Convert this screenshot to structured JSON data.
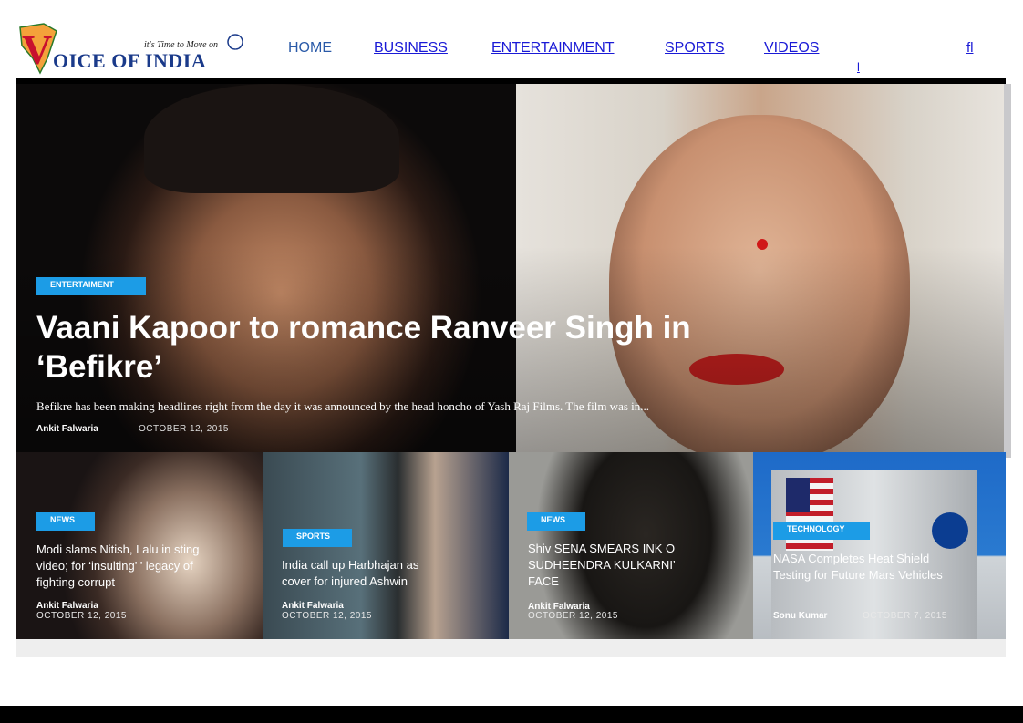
{
  "logo": {
    "letter": "V",
    "wordmark": "OICE OF INDIA",
    "tagline": "it's Time to Move on"
  },
  "nav": {
    "items": [
      "HOME",
      "BUSINESS",
      "ENTERTAINMENT",
      "SPORTS",
      "VIDEOS"
    ],
    "icons": [
      {
        "name": "facebook-icon",
        "glyph": ""
      },
      {
        "name": "twitter-icon",
        "glyph": ""
      },
      {
        "name": "google-plus-icon",
        "glyph": ""
      },
      {
        "name": "search-icon",
        "glyph": "ﬂ"
      }
    ],
    "overflow_glyph": "l"
  },
  "hero": {
    "category": "ENTERTAIMENT",
    "title": "Vaani Kapoor to        romance Ranveer Singh in ‘Befikre’",
    "excerpt": "Befikre has been making headlines right from the day it was announced by the head honcho of Yash Raj Films. The film was in...",
    "author": "Ankit Falwaria",
    "date": "OCTOBER 12, 2015"
  },
  "cards": [
    {
      "category": "NEWS",
      "title": "Modi slams Nitish, Lalu in sting video; for ‘insulting’        ’ legacy of fighting corrupt",
      "author": "Ankit Falwaria",
      "date": "OCTOBER 12, 2015"
    },
    {
      "category": "SPORTS",
      "title": "India call up Harbhajan as cover for injured Ashwin",
      "author": "Ankit Falwaria",
      "date": "OCTOBER 12, 2015"
    },
    {
      "category": "NEWS",
      "title": "Shiv SENA SMEARS INK O SUDHEENDRA KULKARNI’ FACE",
      "author": "Ankit Falwaria",
      "date": "OCTOBER 12, 2015"
    },
    {
      "category": "TECHNOLOGY",
      "title": "NASA Completes Heat Shield Testing for Future Mars Vehicles",
      "author": "Sonu Kumar",
      "date": "OCTOBER 7, 2015"
    }
  ],
  "colors": {
    "accent": "#1c9ce6",
    "link": "#1a1ad6",
    "brand_red": "#c8102e",
    "brand_blue": "#1a3a8a"
  }
}
